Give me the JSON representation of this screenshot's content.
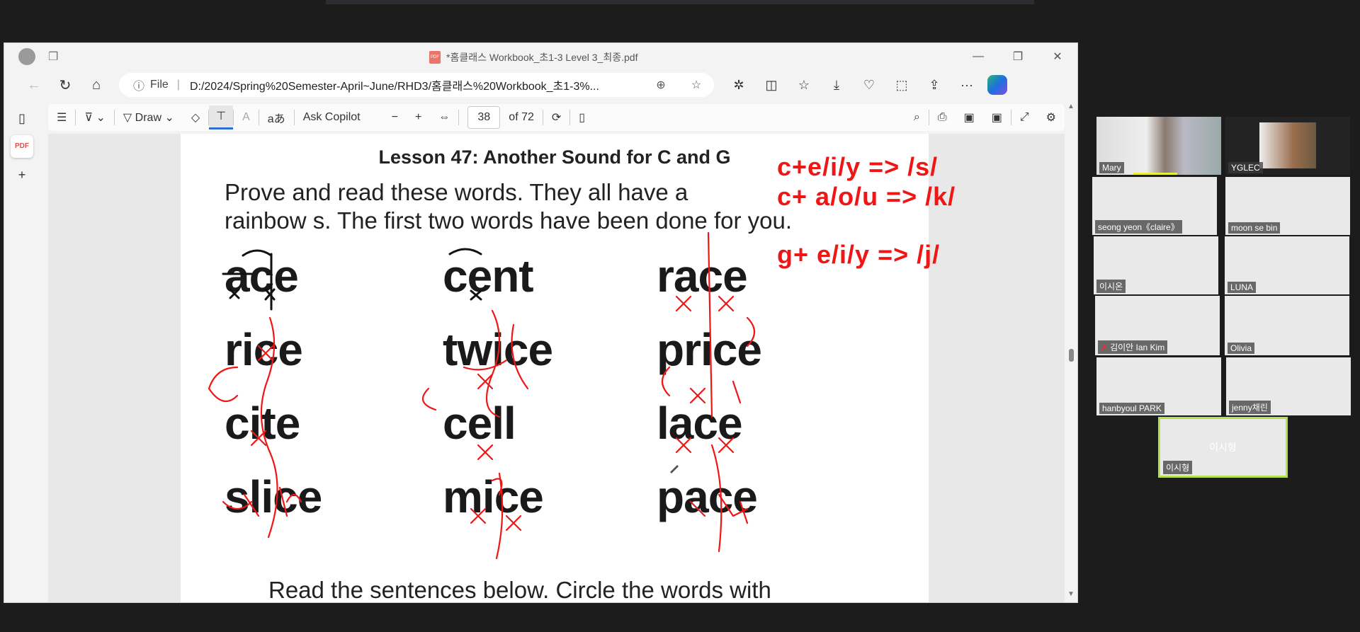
{
  "browser": {
    "title": "*홈클래스 Workbook_초1-3 Level 3_최종.pdf",
    "file_label": "File",
    "url": "D:/2024/Spring%20Semester-April~June/RHD3/홈클래스%20Workbook_초1-3%..."
  },
  "pdf_toolbar": {
    "draw": "Draw",
    "ask_copilot": "Ask Copilot",
    "page": "38",
    "of_pages": "of 72",
    "read_aloud": "aあ",
    "text_a": "A"
  },
  "document": {
    "title": "Lesson 47: Another Sound for C and G",
    "instruction_line1": "Prove and read these words. They all have a",
    "instruction_line2": "rainbow s. The first two words have been done for you.",
    "words": [
      [
        "ace",
        "cent",
        "race"
      ],
      [
        "rice",
        "twice",
        "price"
      ],
      [
        "cite",
        "cell",
        "lace"
      ],
      [
        "slice",
        "mice",
        "pace"
      ]
    ],
    "bottom_line": "Read the sentences below. Circle the words with"
  },
  "annotations": {
    "rules": [
      "c+e/i/y => /s/",
      "c+ a/o/u => /k/",
      "g+ e/i/y => /j/"
    ],
    "color": "#f01616"
  },
  "participants": [
    "Mary",
    "YGLEC",
    "seong yeon《claire》",
    "moon se bin",
    "이시온",
    "LUNA",
    "김이안 Ian Kim",
    "Olivia",
    "hanbyoul PARK",
    "jenny채린",
    "이시형"
  ],
  "active_speaker_overlay": "이시형"
}
